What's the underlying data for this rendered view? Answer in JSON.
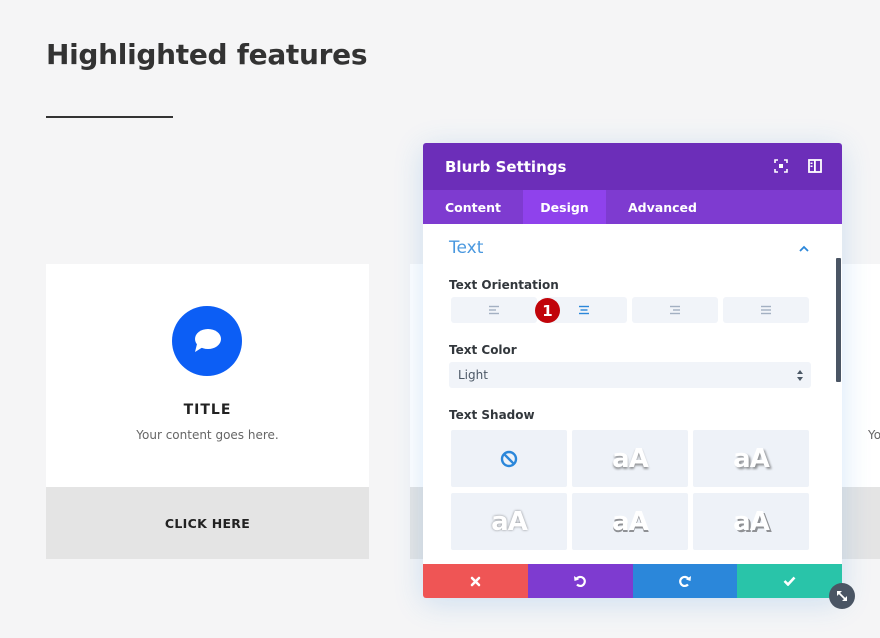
{
  "page": {
    "title": "Highlighted features"
  },
  "cards": [
    {
      "title": "TITLE",
      "text": "Your content goes here.",
      "button": "CLICK HERE",
      "icon": "chat-bubble-icon",
      "icon_color": "#0c5ef5"
    },
    {
      "title": "",
      "text": "",
      "button": ""
    },
    {
      "title": "",
      "text": "Yo",
      "button": ""
    }
  ],
  "modal": {
    "title": "Blurb Settings",
    "header_icons": [
      "focus-mode-icon",
      "sidebar-toggle-icon"
    ],
    "tabs": [
      {
        "label": "Content",
        "active": false
      },
      {
        "label": "Design",
        "active": true
      },
      {
        "label": "Advanced",
        "active": false
      }
    ],
    "section": {
      "title": "Text",
      "expanded": true
    },
    "text_orientation": {
      "label": "Text Orientation",
      "options": [
        "left",
        "center",
        "right",
        "justified"
      ],
      "selected": "center",
      "badge": "1"
    },
    "text_color": {
      "label": "Text Color",
      "value": "Light"
    },
    "text_shadow": {
      "label": "Text Shadow",
      "preview_text": "aA",
      "options": [
        "none",
        "preset-1",
        "preset-2",
        "preset-3",
        "preset-4",
        "preset-5"
      ]
    },
    "footer": {
      "buttons": [
        "discard",
        "undo",
        "redo",
        "save"
      ],
      "colors": {
        "discard": "#ef5555",
        "undo": "#7e3bd0",
        "redo": "#2b87da",
        "save": "#29c4a9"
      }
    }
  },
  "colors": {
    "header": "#6c2eb9",
    "tabs": "#7e3bd0",
    "active_tab": "#8f42ec",
    "accent": "#2b87da",
    "badge": "#c1040a"
  }
}
